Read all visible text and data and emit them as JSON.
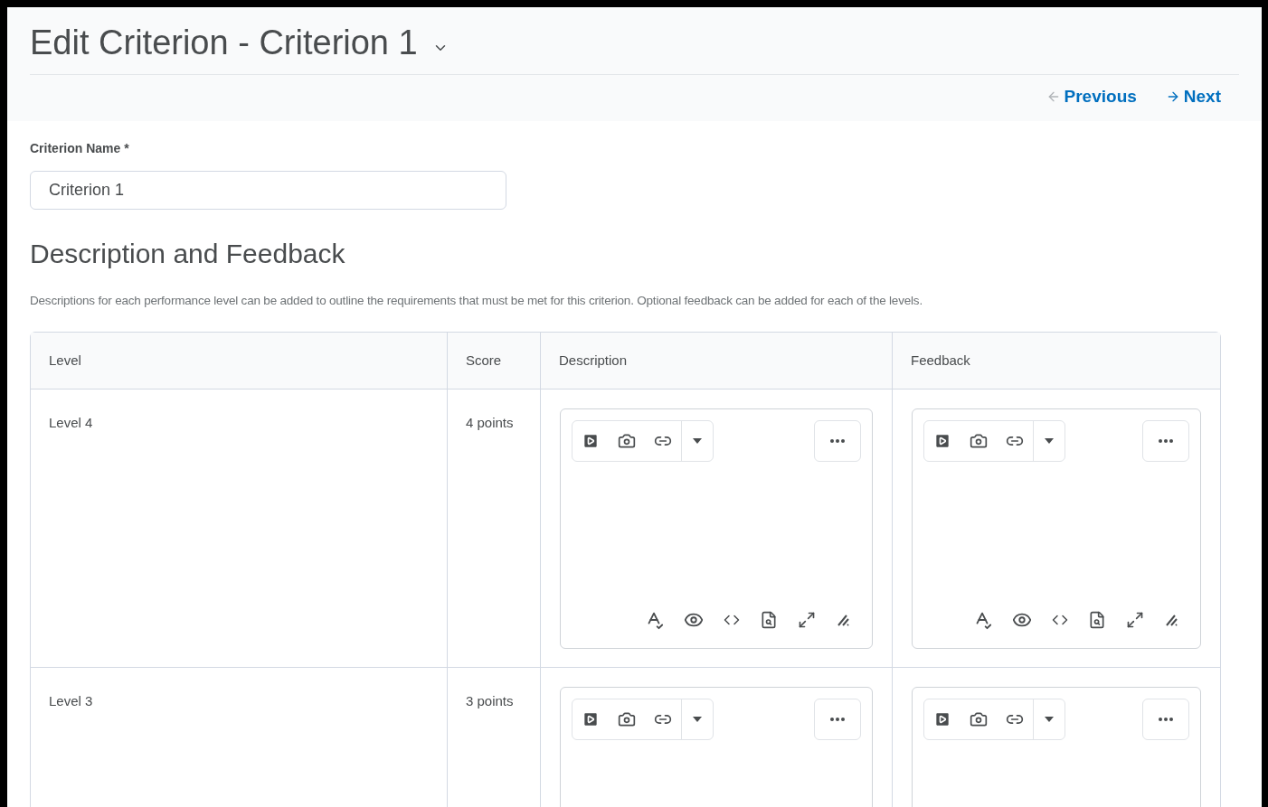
{
  "page_title": "Edit Criterion - Criterion 1",
  "nav": {
    "previous": "Previous",
    "next": "Next"
  },
  "criterion_name": {
    "label": "Criterion Name *",
    "value": "Criterion 1"
  },
  "section": {
    "heading": "Description and Feedback",
    "text": "Descriptions for each performance level can be added to outline the requirements that must be met for this criterion. Optional feedback can be added for each of the levels."
  },
  "table": {
    "columns": [
      "Level",
      "Score",
      "Description",
      "Feedback"
    ],
    "rows": [
      {
        "level": "Level 4",
        "score": "4 points"
      },
      {
        "level": "Level 3",
        "score": "3 points"
      }
    ]
  }
}
